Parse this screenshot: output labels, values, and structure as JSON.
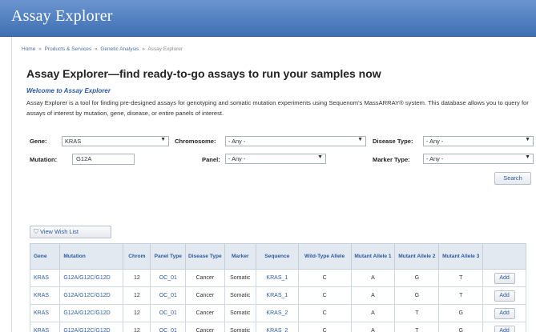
{
  "header": {
    "title": "Assay Explorer"
  },
  "breadcrumb": {
    "items": [
      "Home",
      "Products & Services",
      "Genetic Analysis"
    ],
    "current": "Assay Explorer",
    "separator": "»"
  },
  "page": {
    "title": "Assay Explorer—find ready-to-go assays to run your samples now",
    "welcome": "Welcome to Assay Explorer",
    "description": "Assay Explorer is a tool for finding pre-designed assays for genotyping and somatic mutation experiments using Sequenom's MassARRAY® system. This database allows you to query for assays of interest by mutation, gene, disease, or entire panels of interest."
  },
  "filters": {
    "gene_label": "Gene:",
    "gene_value": "KRAS",
    "chromosome_label": "Chromosome:",
    "chromosome_value": "- Any -",
    "disease_label": "Disease Type:",
    "disease_value": "- Any -",
    "mutation_label": "Mutation:",
    "mutation_value": "G12A",
    "panel_label": "Panel:",
    "panel_value": "- Any -",
    "marker_label": "Marker Type:",
    "marker_value": "- Any -",
    "search_label": "Search"
  },
  "wishlist": {
    "label": "View Wish List"
  },
  "table": {
    "headers": [
      "Gene",
      "Mutation",
      "Chrom",
      "Panel Type",
      "Disease Type",
      "Marker",
      "Sequence",
      "Wild-Type Allele",
      "Mutant Allele 1",
      "Mutant Allele 2",
      "Mutant Allele 3",
      ""
    ],
    "add_label": "Add",
    "rows": [
      [
        "KRAS",
        "G12A/G12C/G12D",
        "12",
        "OC_01",
        "Cancer",
        "Somatic",
        "KRAS_1",
        "C",
        "A",
        "G",
        "T"
      ],
      [
        "KRAS",
        "G12A/G12C/G12D",
        "12",
        "OC_01",
        "Cancer",
        "Somatic",
        "KRAS_1",
        "C",
        "A",
        "G",
        "T"
      ],
      [
        "KRAS",
        "G12A/G12C/G12D",
        "12",
        "OC_01",
        "Cancer",
        "Somatic",
        "KRAS_2",
        "C",
        "A",
        "T",
        "G"
      ],
      [
        "KRAS",
        "G12A/G12C/G12D",
        "12",
        "OC_01",
        "Cancer",
        "Somatic",
        "KRAS_2",
        "C",
        "A",
        "T",
        "G"
      ]
    ]
  },
  "colors": {
    "header_blue": "#3f6fb3",
    "link_blue": "#2c5aa0",
    "table_header_bg": "#e3e9f1"
  }
}
